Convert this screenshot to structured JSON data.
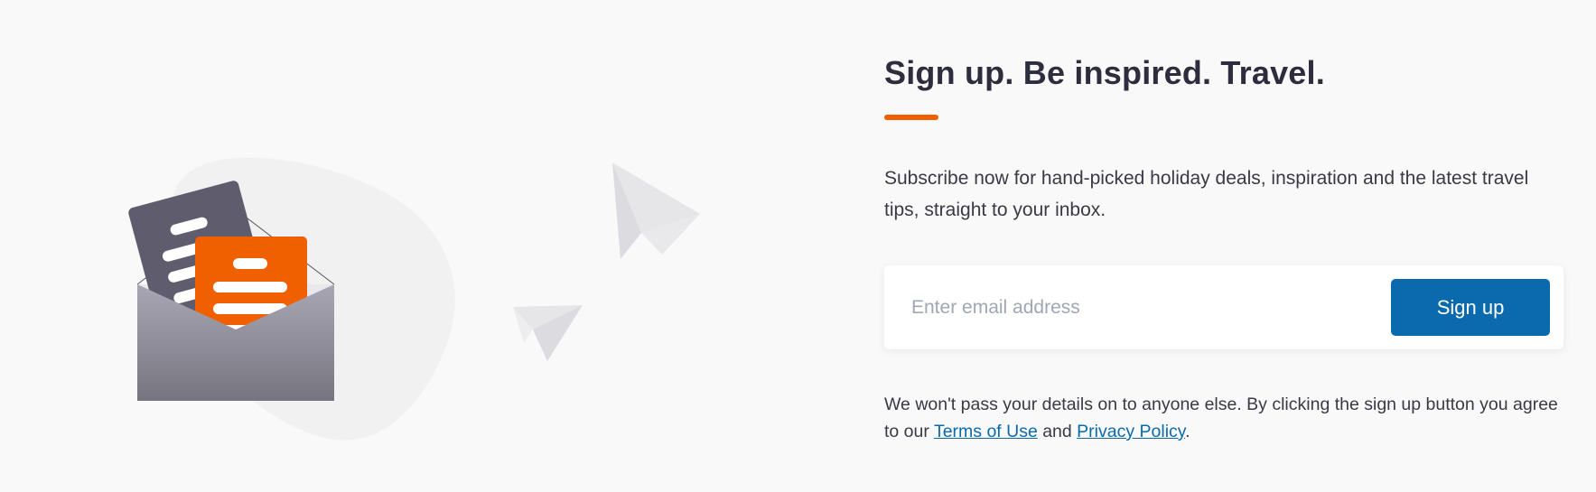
{
  "illustration": {
    "envelope_icon": "open-envelope-with-letters",
    "paper_plane_icon": "paper-plane",
    "accent_color": "#f05f00",
    "letter_dark_color": "#5e5c6d"
  },
  "signup": {
    "headline": "Sign up. Be inspired. Travel.",
    "description": "Subscribe now for hand-picked holiday deals, inspiration and the latest travel tips, straight to your inbox.",
    "email_placeholder": "Enter email address",
    "email_value": "",
    "button_label": "Sign up",
    "disclaimer_prefix": "We won't pass your details on to anyone else. By clicking the sign up button you agree to our ",
    "terms_link": "Terms of Use",
    "and_text": " and ",
    "privacy_link": "Privacy Policy",
    "disclaimer_suffix": "."
  },
  "colors": {
    "accent": "#f05f00",
    "button": "#0a6aad",
    "heading": "#2e2d3d",
    "link": "#0a6aad"
  }
}
